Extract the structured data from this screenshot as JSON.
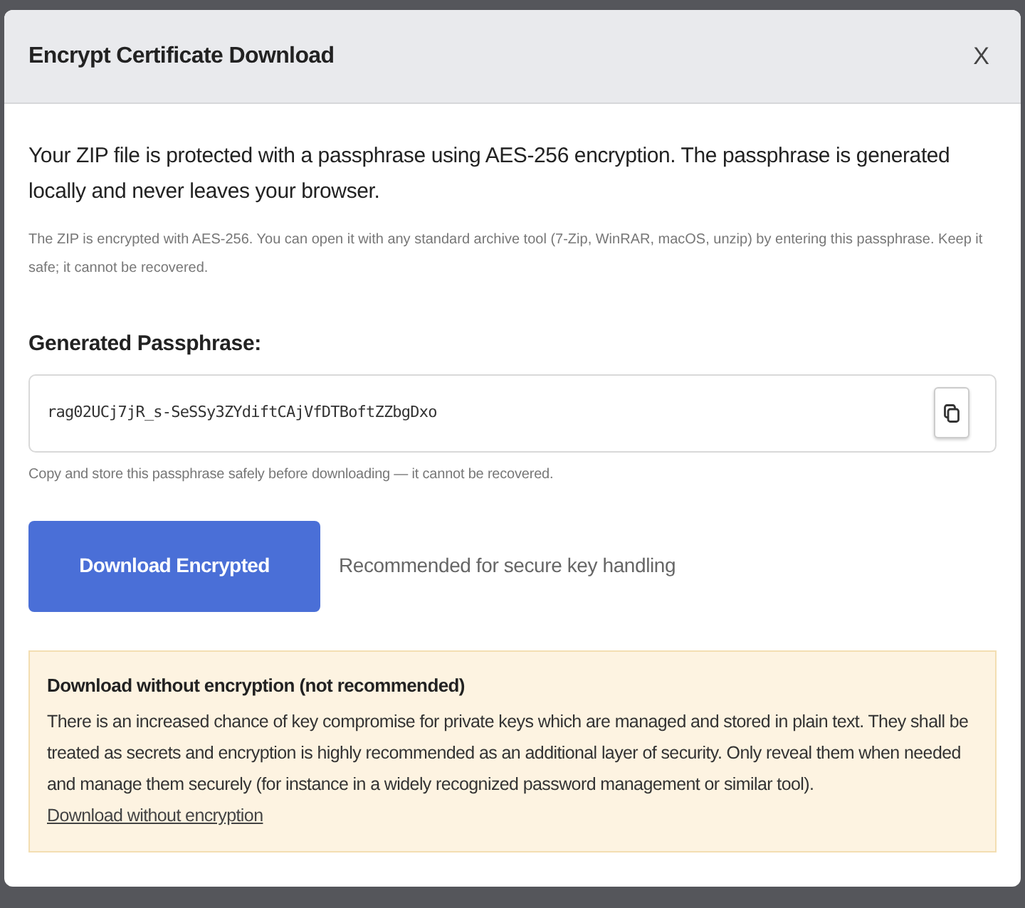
{
  "dialog": {
    "title": "Encrypt Certificate Download",
    "close_label": "X"
  },
  "intro": "Your ZIP file is protected with a passphrase using AES-256 encryption. The passphrase is generated locally and never leaves your browser.",
  "note": "The ZIP is encrypted with AES-256. You can open it with any standard archive tool (7-Zip, WinRAR, macOS, unzip) by entering this passphrase. Keep it safe; it cannot be recovered.",
  "passphrase": {
    "label": "Generated Passphrase:",
    "value": "rag02UCj7jR_s-SeSSy3ZYdiftCAjVfDTBoftZZbgDxo",
    "hint": "Copy and store this passphrase safely before downloading — it cannot be recovered."
  },
  "primary_action": {
    "label": "Download Encrypted",
    "caption": "Recommended for secure key handling"
  },
  "warning": {
    "title": "Download without encryption (not recommended)",
    "text": "There is an increased chance of key compromise for private keys which are managed and stored in plain text. They shall be treated as secrets and encryption is highly recommended as an additional layer of security. Only reveal them when needed and manage them securely (for instance in a widely recognized password management or similar tool).",
    "link": "Download without encryption"
  }
}
